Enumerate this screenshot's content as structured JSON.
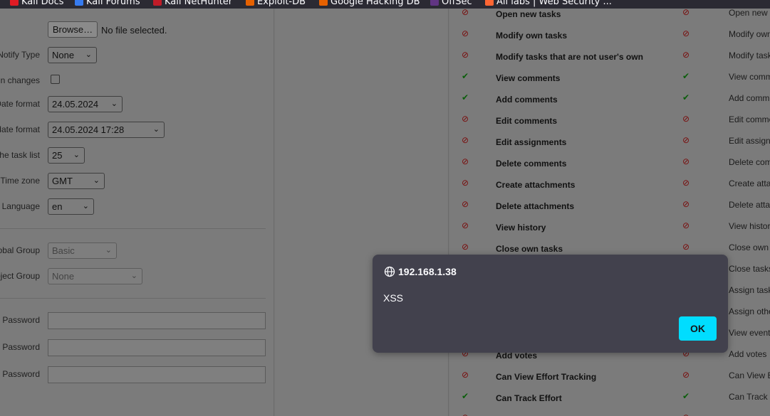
{
  "bookmarks": [
    {
      "label": "Kali Docs",
      "icon": "kali-docs-icon",
      "color": "#e01b24"
    },
    {
      "label": "Kali Forums",
      "icon": "kali-forums-icon",
      "color": "#367bf0"
    },
    {
      "label": "Kali NetHunter",
      "icon": "kali-nethunter-icon",
      "color": "#c01c28"
    },
    {
      "label": "Exploit-DB",
      "icon": "exploit-db-icon",
      "color": "#e66100"
    },
    {
      "label": "Google Hacking DB",
      "icon": "ghdb-icon",
      "color": "#e66100"
    },
    {
      "label": "OffSec",
      "icon": "offsec-icon",
      "color": "#613583"
    },
    {
      "label": "All labs | Web Security ...",
      "icon": "portswigger-icon",
      "color": "#ff6633"
    }
  ],
  "form": {
    "browse_label": "Browse…",
    "no_file": "No file selected.",
    "notify_type": {
      "label": "Notify Type",
      "value": "None"
    },
    "own_changes": {
      "label": "n changes"
    },
    "date_format": {
      "label": "Date format",
      "value": "24.05.2024"
    },
    "datetime_format": {
      "label": "date format",
      "value": "24.05.2024 17:28"
    },
    "task_list": {
      "label": "the task list",
      "value": "25"
    },
    "time_zone": {
      "label": "Time zone",
      "value": "GMT"
    },
    "language": {
      "label": "Language",
      "value": "en"
    },
    "global_group": {
      "label": "obal Group",
      "value": "Basic"
    },
    "project_group": {
      "label": "oject Group",
      "value": "None"
    },
    "password_labels": [
      "Password",
      "Password",
      "Password"
    ]
  },
  "permissions": [
    {
      "label": "Open new tasks",
      "label2": "Open new",
      "state": "deny"
    },
    {
      "label": "Modify own tasks",
      "label2": "Modify own",
      "state": "deny"
    },
    {
      "label": "Modify tasks that are not user's own",
      "label2": "Modify task",
      "state": "deny"
    },
    {
      "label": "View comments",
      "label2": "View comm",
      "state": "allow"
    },
    {
      "label": "Add comments",
      "label2": "Add comm",
      "state": "allow"
    },
    {
      "label": "Edit comments",
      "label2": "Edit comme",
      "state": "deny"
    },
    {
      "label": "Edit assignments",
      "label2": "Edit assign",
      "state": "deny"
    },
    {
      "label": "Delete comments",
      "label2": "Delete com",
      "state": "deny"
    },
    {
      "label": "Create attachments",
      "label2": "Create atta",
      "state": "deny"
    },
    {
      "label": "Delete attachments",
      "label2": "Delete atta",
      "state": "deny"
    },
    {
      "label": "View history",
      "label2": "View histor",
      "state": "deny"
    },
    {
      "label": "Close own tasks",
      "label2": "Close own",
      "state": "deny"
    },
    {
      "label": "",
      "label2": "Close tasks",
      "state": "deny"
    },
    {
      "label": "",
      "label2": "Assign task",
      "state": "deny"
    },
    {
      "label": "",
      "label2": "Assign othe",
      "state": "deny"
    },
    {
      "label": "",
      "label2": "View event",
      "state": "deny"
    },
    {
      "label": "Add votes",
      "label2": "Add votes",
      "state": "deny"
    },
    {
      "label": "Can View Effort Tracking",
      "label2": "Can View E",
      "state": "deny"
    },
    {
      "label": "Can Track Effort",
      "label2": "Can Track",
      "state": "allow"
    },
    {
      "label": "",
      "label2": "",
      "state": "deny"
    }
  ],
  "icons": {
    "deny": "⊘",
    "allow": "✔",
    "chevron": "⌄"
  },
  "dialog": {
    "origin": "192.168.1.38",
    "message": "XSS",
    "ok_label": "OK"
  }
}
